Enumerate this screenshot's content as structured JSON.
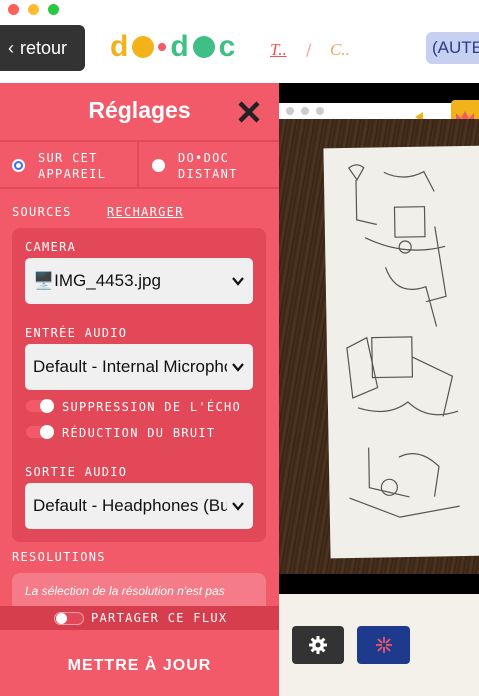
{
  "window": {
    "back_label": "retour",
    "auth_label": "(AUTE"
  },
  "logo": {
    "text": "do•doc"
  },
  "breadcrumb": {
    "first": "T..",
    "separator": "/",
    "second": "C.."
  },
  "settings": {
    "title": "Réglages",
    "device_local": "SUR CET APPAREIL",
    "device_remote": "DO•DOC DISTANT",
    "sources_label": "SOURCES",
    "reload_label": "RECHARGER",
    "camera_label": "CAMERA",
    "camera_value": "🖥️IMG_4453.jpg",
    "audio_in_label": "ENTRÉE AUDIO",
    "audio_in_value": "Default - Internal Microphone",
    "echo_label": "SUPPRESSION DE L'ÉCHO",
    "noise_label": "RÉDUCTION DU BRUIT",
    "audio_out_label": "SORTIE AUDIO",
    "audio_out_value": "Default - Headphones (Built-in)",
    "resolutions_label": "RESOLUTIONS",
    "resolutions_note": "La sélection de la résolution n'est pas",
    "share_label": "PARTAGER CE FLUX",
    "update_label": "METTRE À JOUR",
    "echo_on": true,
    "noise_on": true,
    "share_on": false
  },
  "colors": {
    "panel": "#f25a69",
    "panel_dark": "#e24857",
    "brand_yellow": "#f2b31a",
    "brand_blue": "#1d3a8c"
  }
}
